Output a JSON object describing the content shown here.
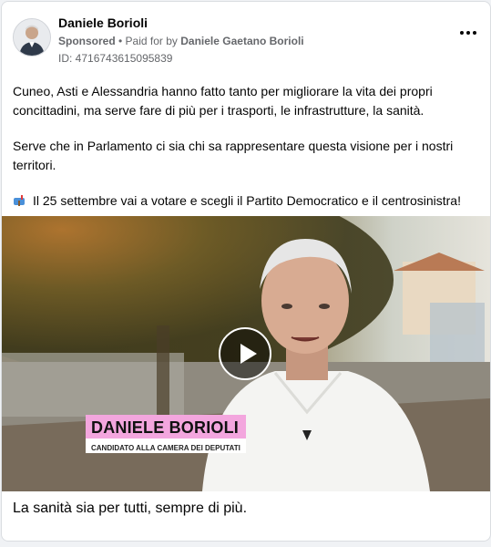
{
  "post": {
    "author": "Daniele Borioli",
    "sponsored_label": "Sponsored",
    "paid_for_prefix": " • Paid for by ",
    "paid_for_name": "Daniele Gaetano Borioli",
    "ad_id": "ID: 4716743615095839",
    "more_icon": "more-horizontal-icon",
    "paragraphs": [
      "Cuneo, Asti e Alessandria hanno fatto tanto per migliorare la vita dei propri concittadini, ma serve fare di più per i trasporti, le infrastrutture, la sanità.",
      "Serve che in Parlamento ci sia chi sa rappresentare questa visione per i nostri territori.",
      "Il 25 settembre vai a votare e scegli il Partito Democratico e il centrosinistra!"
    ],
    "emoji_icon": "mailbox-icon"
  },
  "video": {
    "name_tag": "DANIELE BORIOLI",
    "role_tag": "CANDIDATO ALLA CAMERA DEI DEPUTATI",
    "play_icon": "play-icon"
  },
  "caption": "La sanità sia per tutti, sempre di più.",
  "colors": {
    "name_tag_bg": "#f3a6de",
    "text": "#050505",
    "secondary": "#65676b"
  }
}
